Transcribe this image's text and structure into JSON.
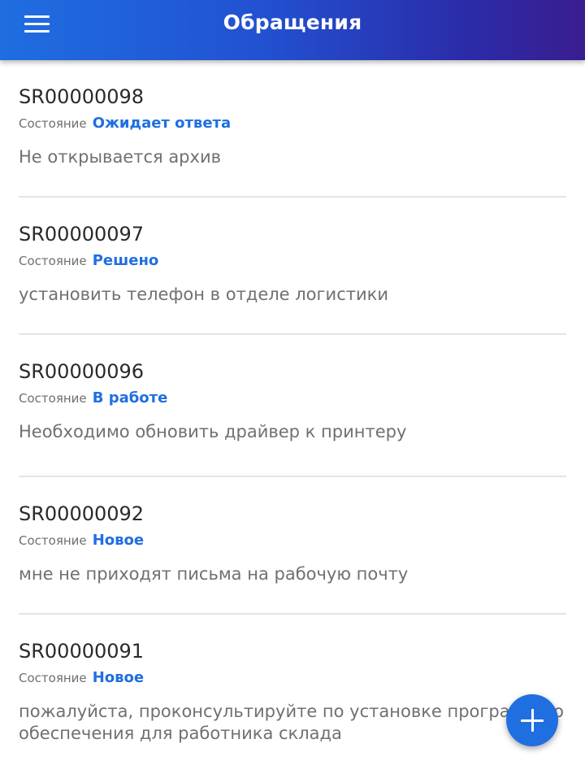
{
  "app_bar": {
    "title": "Обращения",
    "menu_icon": "hamburger-menu-icon"
  },
  "requests": [
    {
      "id": "SR00000098",
      "state_label": "Состояние",
      "state": "Ожидает ответа",
      "description": "Не открывается архив"
    },
    {
      "id": "SR00000097",
      "state_label": "Состояние",
      "state": "Решено",
      "description": "установить телефон в отделе логистики"
    },
    {
      "id": "SR00000096",
      "state_label": "Состояние",
      "state": "В работе",
      "description": "Необходимо обновить драйвер к принтеру"
    },
    {
      "id": "SR00000092",
      "state_label": "Состояние",
      "state": "Новое",
      "description": "мне не приходят письма на рабочую почту"
    },
    {
      "id": "SR00000091",
      "state_label": "Состояние",
      "state": "Новое",
      "description": "пожалуйста, проконсультируйте по установке програмного обеспечения для работника склада"
    }
  ],
  "fab": {
    "icon": "plus-icon"
  },
  "colors": {
    "accent": "#1f6fe0",
    "app_bar_start": "#1e6ee0",
    "app_bar_end": "#3a1d8f"
  }
}
